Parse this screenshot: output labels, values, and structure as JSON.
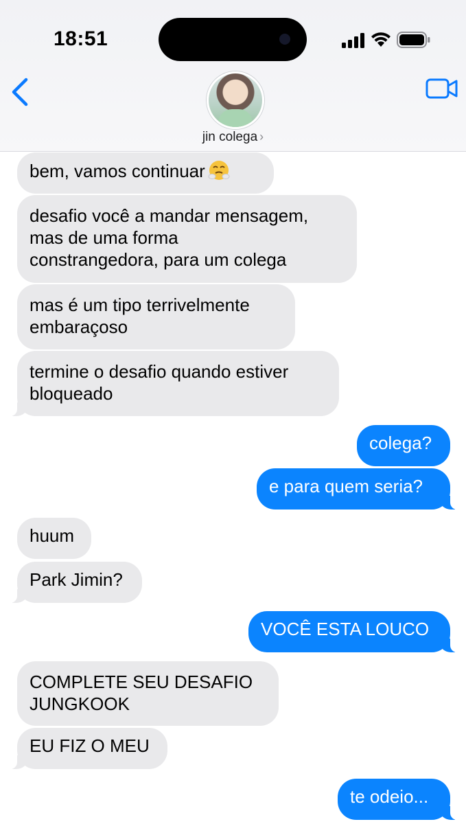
{
  "status": {
    "time": "18:51"
  },
  "header": {
    "contact_name": "jin colega",
    "chevron": "›"
  },
  "colors": {
    "incoming": "#e9e9eb",
    "outgoing": "#0b84fe",
    "accent": "#0a7aff"
  },
  "messages": [
    {
      "dir": "in",
      "text": "bem, vamos continuar",
      "emoji": "face-with-steam-from-nose"
    },
    {
      "dir": "in",
      "lines": [
        "desafio você a mandar mensagem,",
        "mas de uma forma",
        "constrangedora, para um colega"
      ]
    },
    {
      "dir": "in",
      "lines": [
        "mas é um tipo terrivelmente",
        "embaraçoso"
      ]
    },
    {
      "dir": "in",
      "lines": [
        "termine o desafio quando estiver",
        "bloqueado"
      ]
    },
    {
      "dir": "out",
      "text": "colega?"
    },
    {
      "dir": "out",
      "text": "e para quem seria?"
    },
    {
      "dir": "in",
      "text": "huum"
    },
    {
      "dir": "in",
      "text": "Park Jimin?"
    },
    {
      "dir": "out",
      "text": "VOCÊ ESTA LOUCO"
    },
    {
      "dir": "in",
      "lines": [
        "COMPLETE SEU DESAFIO",
        "JUNGKOOK"
      ]
    },
    {
      "dir": "in",
      "text": "EU FIZ O MEU"
    },
    {
      "dir": "out",
      "text": "te odeio..."
    }
  ]
}
